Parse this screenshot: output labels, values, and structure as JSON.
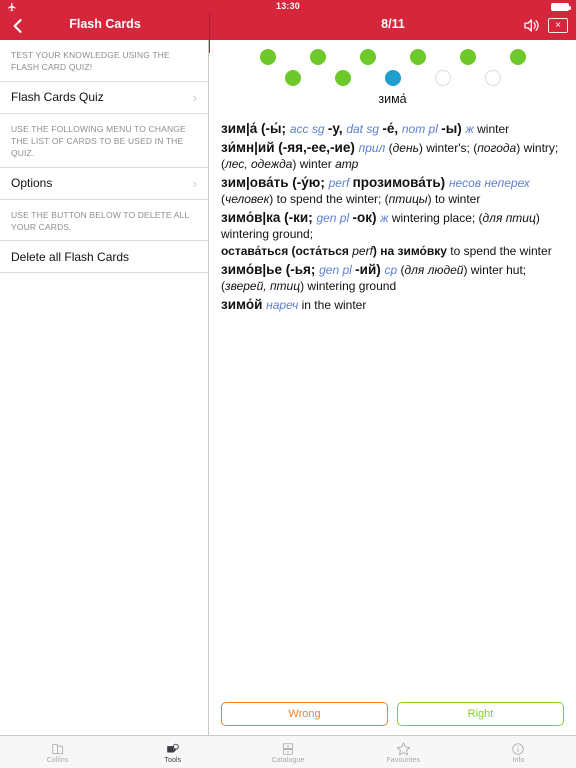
{
  "status_bar": {
    "time": "13:30",
    "airplane_icon": "airplane-mode-icon",
    "battery_icon": "battery-full-icon"
  },
  "nav": {
    "back_icon": "back-chevron-icon",
    "left_title": "Flash Cards",
    "right_title": "8/11",
    "speaker_icon": "speaker-icon",
    "close_label": "×"
  },
  "sidebar": {
    "note_top": "TEST YOUR KNOWLEDGE USING THE FLASH CARD QUIZ!",
    "row_quiz": "Flash Cards Quiz",
    "note_middle": "USE THE FOLLOWING MENU TO CHANGE THE LIST OF CARDS TO BE USED IN THE QUIZ.",
    "row_options": "Options",
    "note_bottom": "USE THE BUTTON BELOW TO DELETE ALL YOUR CARDS.",
    "row_delete": "Delete all Flash Cards",
    "chevron": "›"
  },
  "quiz": {
    "headword": "зима́",
    "progress": {
      "total": 11,
      "current_index": 9,
      "row1": [
        "done",
        "done",
        "done",
        "done",
        "done",
        "done"
      ],
      "row2": [
        "done",
        "done",
        "current",
        "empty",
        "empty"
      ]
    },
    "buttons": {
      "wrong": "Wrong",
      "right": "Right"
    }
  },
  "entry": {
    "lines": [
      {
        "parts": [
          {
            "t": "зим|а́ (-ы́; ",
            "s": "hw"
          },
          {
            "t": "acc sg ",
            "s": "gram"
          },
          {
            "t": "-у, ",
            "s": "hw"
          },
          {
            "t": "dat sg ",
            "s": "gram"
          },
          {
            "t": "-е́, ",
            "s": "hw"
          },
          {
            "t": "nom pl ",
            "s": "gram"
          },
          {
            "t": "-ы) ",
            "s": "hw"
          },
          {
            "t": "ж ",
            "s": "gram"
          },
          {
            "t": "winter",
            "s": "plain"
          }
        ]
      },
      {
        "parts": [
          {
            "t": "зи́мн|ий (-яя,-ее,-ие) ",
            "s": "hw"
          },
          {
            "t": "прил ",
            "s": "gram"
          },
          {
            "t": "(",
            "s": "plain"
          },
          {
            "t": "день",
            "s": "it"
          },
          {
            "t": ") winter's; (",
            "s": "plain"
          },
          {
            "t": "погода",
            "s": "it"
          },
          {
            "t": ") wintry; (",
            "s": "plain"
          },
          {
            "t": "лес, одежда",
            "s": "it"
          },
          {
            "t": ") winter ",
            "s": "plain"
          },
          {
            "t": "атр",
            "s": "it"
          }
        ]
      },
      {
        "parts": [
          {
            "t": "зим|ова́ть (-у́ю; ",
            "s": "hw"
          },
          {
            "t": "perf ",
            "s": "gram"
          },
          {
            "t": "прозимова́ть) ",
            "s": "hw"
          },
          {
            "t": "несов неперех",
            "s": "gram"
          },
          {
            "t": " (",
            "s": "plain"
          },
          {
            "t": "человек",
            "s": "it"
          },
          {
            "t": ") to spend the winter; (",
            "s": "plain"
          },
          {
            "t": "птицы",
            "s": "it"
          },
          {
            "t": ") to winter",
            "s": "plain"
          }
        ]
      },
      {
        "parts": [
          {
            "t": "зимо́в|ка (-ки; ",
            "s": "hw"
          },
          {
            "t": "gen pl ",
            "s": "gram"
          },
          {
            "t": "-ок) ",
            "s": "hw"
          },
          {
            "t": "ж ",
            "s": "gram"
          },
          {
            "t": "wintering place; (",
            "s": "plain"
          },
          {
            "t": "для птиц",
            "s": "it"
          },
          {
            "t": ") wintering ground;",
            "s": "plain"
          }
        ]
      },
      {
        "parts": [
          {
            "t": "остава́ться (оста́ться ",
            "s": "b"
          },
          {
            "t": "perf",
            "s": "it"
          },
          {
            "t": ") на зимо́вку",
            "s": "b"
          },
          {
            "t": " to spend the winter",
            "s": "plain"
          }
        ]
      },
      {
        "parts": [
          {
            "t": "зимо́в|ье (-ья; ",
            "s": "hw"
          },
          {
            "t": "gen pl ",
            "s": "gram"
          },
          {
            "t": "-ий) ",
            "s": "hw"
          },
          {
            "t": "ср ",
            "s": "gram"
          },
          {
            "t": "(",
            "s": "plain"
          },
          {
            "t": "для людей",
            "s": "it"
          },
          {
            "t": ") winter hut; (",
            "s": "plain"
          },
          {
            "t": "зверей, птиц",
            "s": "it"
          },
          {
            "t": ") wintering ground",
            "s": "plain"
          }
        ]
      },
      {
        "parts": [
          {
            "t": "зимо́й ",
            "s": "hw"
          },
          {
            "t": "нареч",
            "s": "gram"
          },
          {
            "t": " in the winter",
            "s": "plain"
          }
        ]
      }
    ]
  },
  "tabbar": {
    "tabs": [
      {
        "label": "Collins",
        "icon": "book-icon",
        "active": false
      },
      {
        "label": "Tools",
        "icon": "tools-icon",
        "active": true
      },
      {
        "label": "Catalogue",
        "icon": "catalogue-icon",
        "active": false
      },
      {
        "label": "Favourites",
        "icon": "star-icon",
        "active": false
      },
      {
        "label": "Info",
        "icon": "info-icon",
        "active": false
      }
    ]
  },
  "colors": {
    "brand_red": "#d5263b",
    "done_green": "#6dc82a",
    "current_blue": "#1f9fd0",
    "gram_blue": "#5b7fd4",
    "wrong_orange": "#f0832a",
    "right_green": "#7ed321"
  }
}
